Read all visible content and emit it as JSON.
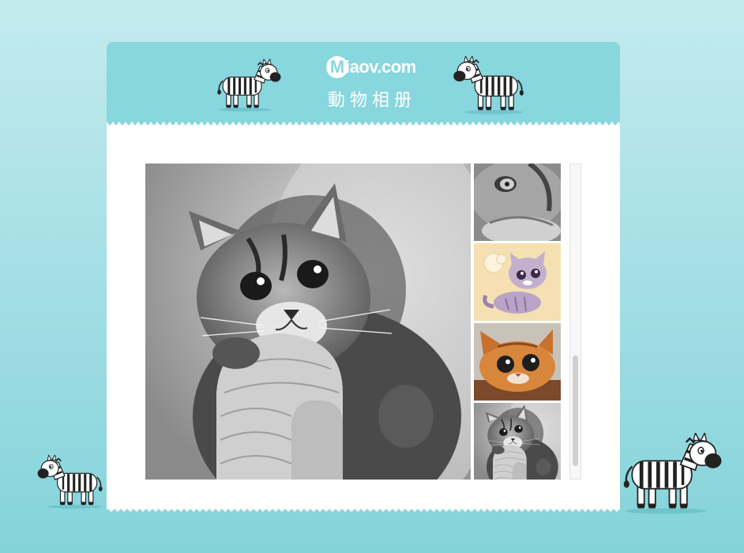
{
  "header": {
    "logo_initial": "M",
    "logo_text": "iaov.com",
    "album_title": "動物相册"
  },
  "gallery": {
    "main_photo": "cat-grayscale-hugging-knit-toy",
    "thumbnails": [
      {
        "photo": "cat-grayscale-closeup"
      },
      {
        "photo": "cartoon-cat-purple"
      },
      {
        "photo": "orange-kitten-peeking"
      },
      {
        "photo": "cat-grayscale-hugging-knit-toy"
      }
    ]
  },
  "colors": {
    "header_bg": "#88d6de",
    "page_bg_top": "#c3ebee",
    "page_bg_bottom": "#84d3da",
    "panel_bg": "#ffffff"
  },
  "icons": [
    "zebra-icon"
  ]
}
